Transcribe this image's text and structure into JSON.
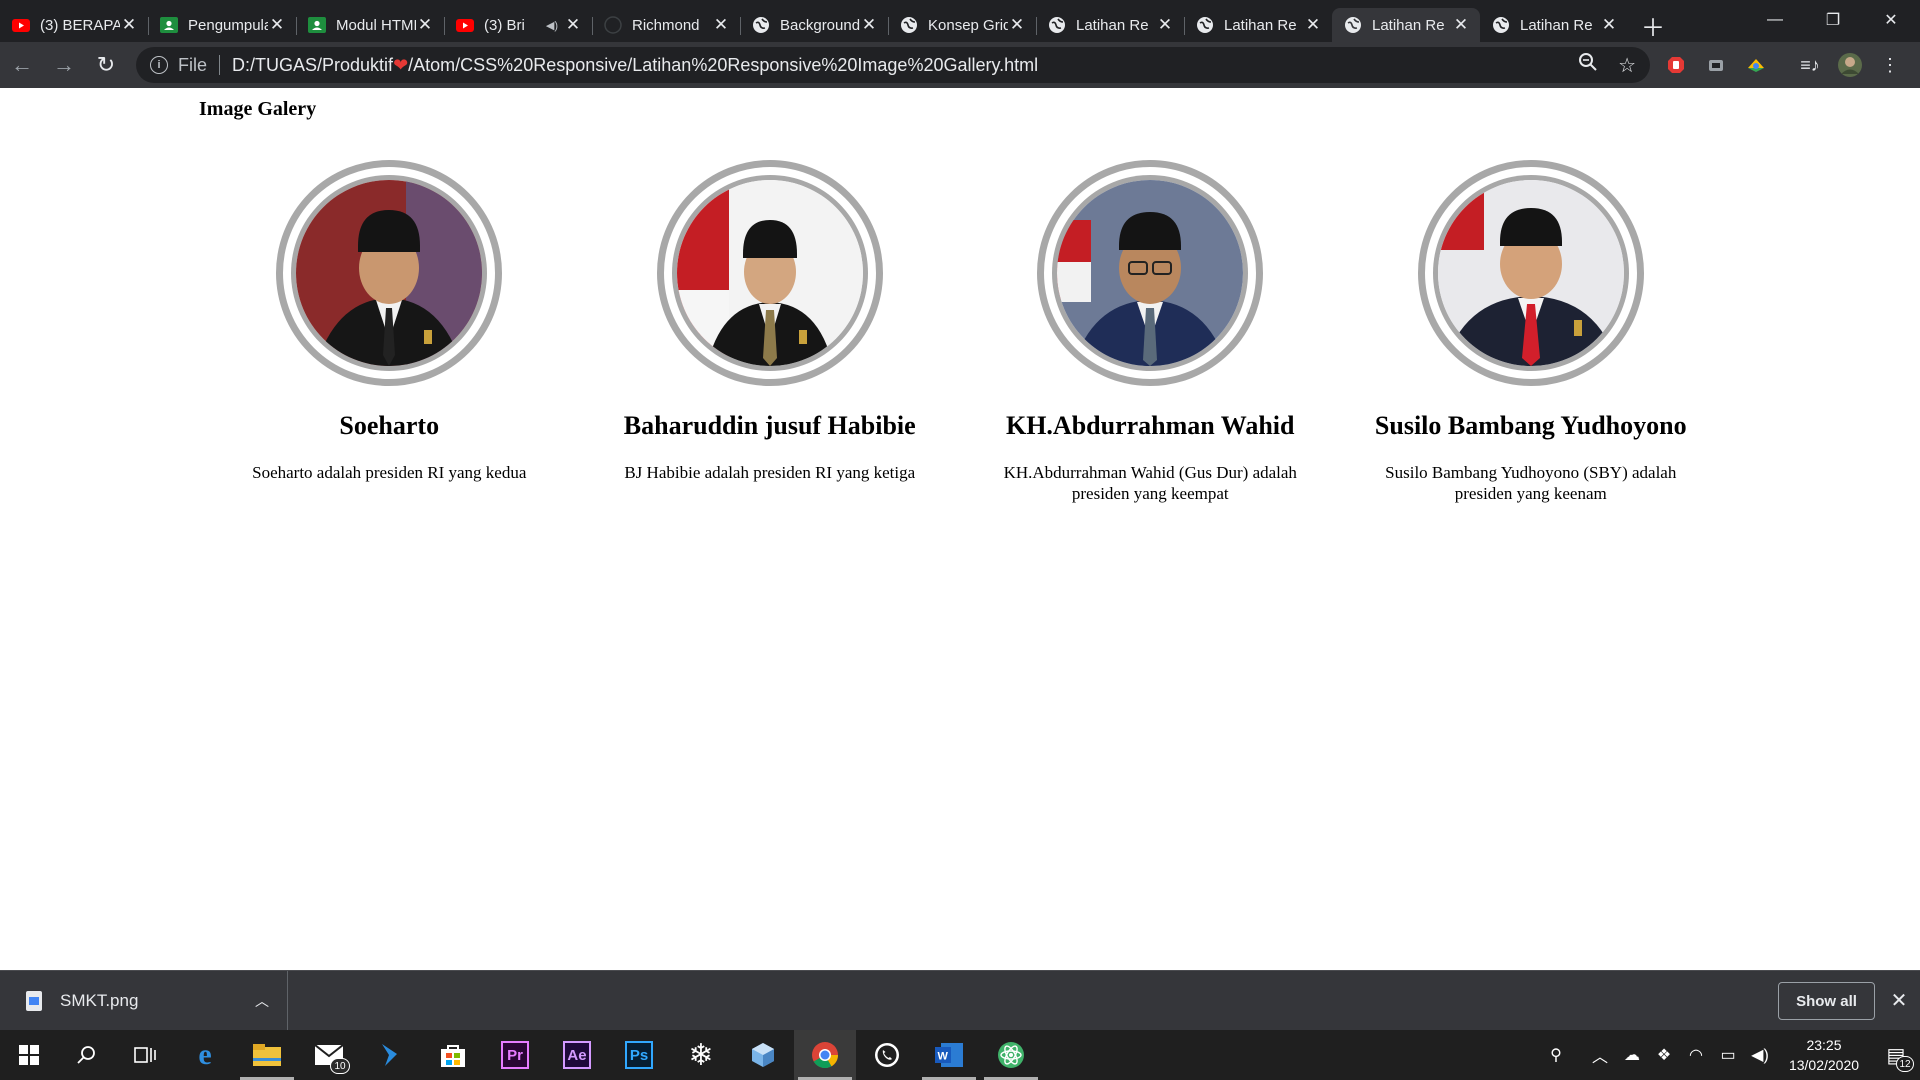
{
  "browser": {
    "tabs": [
      {
        "title": "(3) BERAPA",
        "favicon": "youtube-icon",
        "active": false,
        "audio": false
      },
      {
        "title": "Pengumpulan",
        "favicon": "google-classroom-icon",
        "active": false,
        "audio": false
      },
      {
        "title": "Modul HTML",
        "favicon": "google-classroom-icon",
        "active": false,
        "audio": false
      },
      {
        "title": "(3) Bri",
        "favicon": "youtube-icon",
        "active": false,
        "audio": true
      },
      {
        "title": "Richmond",
        "favicon": "github-icon",
        "active": false,
        "audio": false
      },
      {
        "title": "Background",
        "favicon": "globe-icon",
        "active": false,
        "audio": false
      },
      {
        "title": "Konsep Grid",
        "favicon": "globe-icon",
        "active": false,
        "audio": false
      },
      {
        "title": "Latihan Re",
        "favicon": "globe-icon",
        "active": false,
        "audio": false
      },
      {
        "title": "Latihan Re",
        "favicon": "globe-icon",
        "active": false,
        "audio": false
      },
      {
        "title": "Latihan Re",
        "favicon": "globe-icon",
        "active": true,
        "audio": false
      },
      {
        "title": "Latihan Re",
        "favicon": "globe-icon",
        "active": false,
        "audio": false
      }
    ],
    "address": {
      "scheme_label": "File",
      "url_before_icon": "D:/TUGAS/Produktif",
      "url_after_icon": "/Atom/CSS%20Responsive/Latihan%20Responsive%20Image%20Gallery.html"
    }
  },
  "page": {
    "title": "Image Galery",
    "cards": [
      {
        "name": "Soeharto",
        "description": "Soeharto adalah presiden RI yang kedua",
        "accent": "#8a2a2a",
        "suit": "#1a1a1a"
      },
      {
        "name": "Baharuddin jusuf Habibie",
        "description": "BJ Habibie adalah presiden RI yang ketiga",
        "accent": "#c41e24",
        "suit": "#151515"
      },
      {
        "name": "KH.Abdurrahman Wahid",
        "description": "KH.Abdurrahman Wahid (Gus Dur) adalah presiden yang keempat",
        "accent": "#6d7a96",
        "suit": "#1f2d57"
      },
      {
        "name": "Susilo Bambang Yudhoyono",
        "description": "Susilo Bambang Yudhoyono (SBY) adalah presiden yang keenam",
        "accent": "#c41e24",
        "suit": "#1d2233"
      }
    ]
  },
  "downloads": {
    "file_name": "SMKT.png",
    "show_all_label": "Show all"
  },
  "taskbar": {
    "mail_badge": "10",
    "notification_badge": "12",
    "time": "23:25",
    "date": "13/02/2020",
    "apps": [
      "edge-icon",
      "file-explorer-icon",
      "mail-icon",
      "visual-studio-code-icon",
      "store-icon",
      "premiere-pro-icon",
      "after-effects-icon",
      "photoshop-icon",
      "snowflake-app-icon",
      "3d-box-icon",
      "chrome-icon",
      "whatsapp-icon",
      "word-icon",
      "atom-icon"
    ]
  },
  "colors": {
    "chrome_dark": "#202124",
    "chrome_toolbar": "#35363a",
    "photo_ring": "#a8a8a8",
    "taskbar": "#1f1f1f"
  }
}
